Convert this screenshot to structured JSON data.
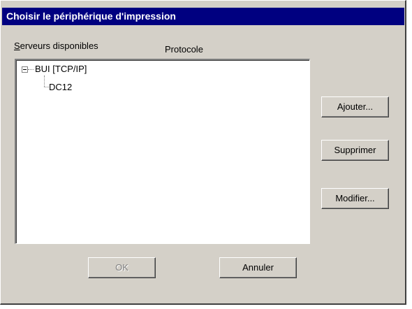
{
  "window": {
    "title": "Choisir le périphérique d'impression"
  },
  "labels": {
    "servers": "Serveurs disponibles",
    "servers_rest": "erveurs disponibles",
    "servers_mnemonic": "S",
    "protocol": "Protocole"
  },
  "tree": {
    "root": {
      "label": "BUI  [TCP/IP]",
      "expanded": true
    },
    "children": [
      {
        "label": "DC12"
      }
    ]
  },
  "buttons": {
    "add": "Ajouter...",
    "remove": "Supprimer",
    "modify": "Modifier...",
    "ok": "OK",
    "cancel": "Annuler"
  },
  "state": {
    "ok_enabled": false
  },
  "icons": {
    "expander": "minus-box-icon"
  }
}
